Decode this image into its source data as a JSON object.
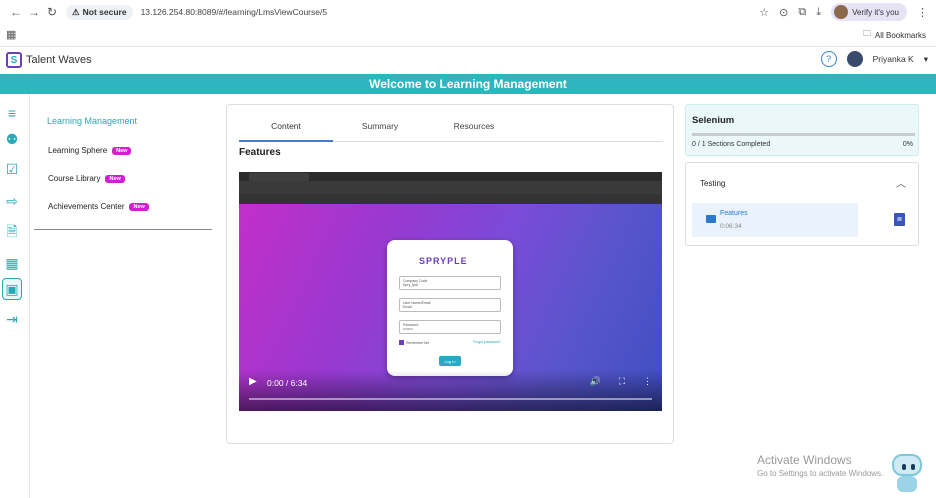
{
  "browser": {
    "security_label": "Not secure",
    "url": "13.126.254.80:8089/#/learning/LmsViewCourse/5",
    "profile_label": "Verify it's you",
    "bookmarks_label": "All Bookmarks"
  },
  "header": {
    "app_name": "Talent Waves",
    "user_name": "Priyanka K",
    "banner": "Welcome to Learning Management"
  },
  "left_nav": {
    "title": "Learning Management",
    "items": [
      {
        "label": "Learning Sphere",
        "badge": "New"
      },
      {
        "label": "Course Library",
        "badge": "New"
      },
      {
        "label": "Achievements Center",
        "badge": "New"
      }
    ]
  },
  "main": {
    "tabs": [
      "Content",
      "Summary",
      "Resources"
    ],
    "active_tab": "Content",
    "section_title": "Features",
    "video": {
      "time": "0:00 / 6:34",
      "brand": "SPRYPLE",
      "fields": [
        "Company Code",
        "User Name/Email",
        "Password"
      ],
      "field_values": [
        "Spry_Ipal",
        "Email",
        "••••••••"
      ],
      "remember": "Remember Me",
      "forgot": "Forgot password?",
      "login": "Log In"
    }
  },
  "course_panel": {
    "title": "Selenium",
    "progress_text": "0 / 1 Sections Completed",
    "percent": "0%",
    "percent_value": 0,
    "section": "Testing",
    "lesson_title": "Features",
    "lesson_duration": "0:06:34"
  },
  "watermark": {
    "line1": "Activate Windows",
    "line2": "Go to Settings to activate Windows."
  }
}
